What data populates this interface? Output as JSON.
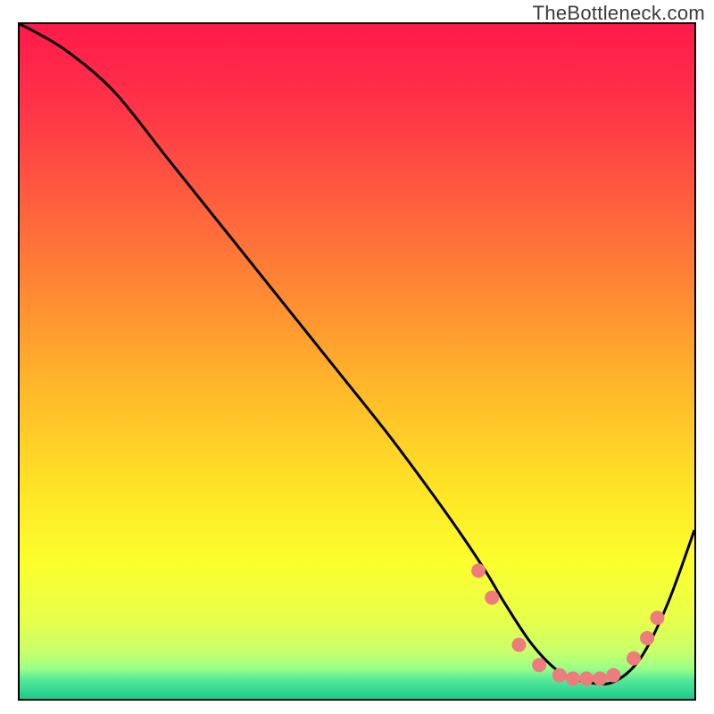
{
  "watermark": "TheBottleneck.com",
  "chart_data": {
    "type": "line",
    "title": "",
    "xlabel": "",
    "ylabel": "",
    "xlim": [
      0,
      100
    ],
    "ylim": [
      0,
      100
    ],
    "grid": false,
    "legend": false,
    "background_gradient_stops": [
      {
        "offset": 0.0,
        "color": "#ff1a4b"
      },
      {
        "offset": 0.12,
        "color": "#ff3348"
      },
      {
        "offset": 0.25,
        "color": "#ff5a3f"
      },
      {
        "offset": 0.4,
        "color": "#ff8a33"
      },
      {
        "offset": 0.55,
        "color": "#ffbb2a"
      },
      {
        "offset": 0.7,
        "color": "#ffe726"
      },
      {
        "offset": 0.8,
        "color": "#fbff2d"
      },
      {
        "offset": 0.88,
        "color": "#e8ff4a"
      },
      {
        "offset": 0.93,
        "color": "#c8ff6a"
      },
      {
        "offset": 0.955,
        "color": "#9aff88"
      },
      {
        "offset": 0.972,
        "color": "#55e89a"
      },
      {
        "offset": 1.0,
        "color": "#1acb8e"
      }
    ],
    "series": [
      {
        "name": "bottleneck-curve",
        "color": "#000000",
        "x": [
          0,
          2,
          7,
          14,
          22,
          30,
          38,
          46,
          54,
          60,
          65,
          69,
          72,
          76,
          80,
          84,
          88,
          92,
          96,
          100
        ],
        "y_pct": [
          100,
          99,
          96,
          90,
          80,
          70,
          60,
          50,
          40,
          32,
          25,
          19,
          14,
          8,
          4,
          2.5,
          2.5,
          6,
          14,
          25
        ]
      }
    ],
    "markers": {
      "name": "highlight-dots",
      "color": "#ef7c7c",
      "radius_px": 8,
      "points": [
        {
          "x": 68,
          "y_pct": 19
        },
        {
          "x": 70,
          "y_pct": 15
        },
        {
          "x": 74,
          "y_pct": 8
        },
        {
          "x": 77,
          "y_pct": 5
        },
        {
          "x": 80,
          "y_pct": 3.5
        },
        {
          "x": 82,
          "y_pct": 3
        },
        {
          "x": 84,
          "y_pct": 3
        },
        {
          "x": 86,
          "y_pct": 3
        },
        {
          "x": 88,
          "y_pct": 3.5
        },
        {
          "x": 91,
          "y_pct": 6
        },
        {
          "x": 93,
          "y_pct": 9
        },
        {
          "x": 94.5,
          "y_pct": 12
        }
      ]
    }
  }
}
